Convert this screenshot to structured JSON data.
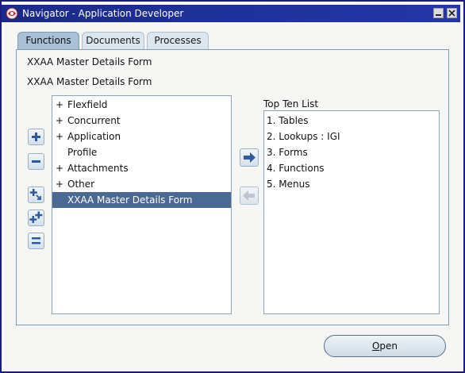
{
  "window": {
    "title": "Navigator - Application Developer"
  },
  "tabs": [
    {
      "label": "Functions",
      "active": true
    },
    {
      "label": "Documents",
      "active": false
    },
    {
      "label": "Processes",
      "active": false
    }
  ],
  "context": {
    "line1": "XXAA Master Details Form",
    "line2": "XXAA Master Details Form"
  },
  "tree": {
    "items": [
      {
        "prefix": "+",
        "label": "Flexfield"
      },
      {
        "prefix": "+",
        "label": "Concurrent"
      },
      {
        "prefix": "+",
        "label": "Application"
      },
      {
        "prefix": "",
        "label": "Profile"
      },
      {
        "prefix": "+",
        "label": "Attachments"
      },
      {
        "prefix": "+",
        "label": "Other"
      },
      {
        "prefix": "",
        "label": "XXAA Master Details Form",
        "selected": true
      }
    ]
  },
  "tree_buttons": [
    "expand-icon",
    "collapse-icon",
    "expand-branch-icon",
    "expand-all-icon",
    "collapse-all-icon"
  ],
  "transfer_buttons": [
    "arrow-right-icon",
    "arrow-left-icon"
  ],
  "top_ten": {
    "label": "Top Ten List",
    "items": [
      "1. Tables",
      "2. Lookups : IGI",
      "3. Forms",
      "4. Functions",
      "5. Menus"
    ]
  },
  "open_button": {
    "mnemonic": "O",
    "rest": "pen"
  },
  "colors": {
    "title_bar": "#1a2a8a",
    "selection": "#4a6a94",
    "tab_active": "#a9c1d6"
  }
}
